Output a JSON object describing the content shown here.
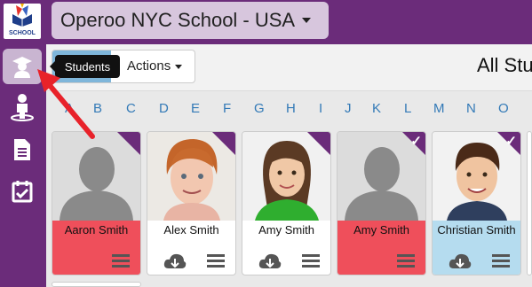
{
  "header": {
    "school_title": "Operoo NYC School - USA",
    "logo_text": "SCHOOL"
  },
  "sidebar": {
    "tooltip": "Students",
    "items": [
      "students-icon",
      "people-icon",
      "document-icon",
      "calendar-check-icon"
    ]
  },
  "toolbar": {
    "actions_label": "Actions",
    "page_heading": "All Stu"
  },
  "alphabet": [
    "A",
    "B",
    "C",
    "D",
    "E",
    "F",
    "G",
    "H",
    "I",
    "J",
    "K",
    "L",
    "M",
    "N",
    "O"
  ],
  "students": [
    {
      "name": "Aaron Smith",
      "status": "red",
      "photo": "placeholder",
      "checked": false,
      "download": false
    },
    {
      "name": "Alex Smith",
      "status": "white",
      "photo": "boy-red-hair",
      "checked": false,
      "download": true
    },
    {
      "name": "Amy Smith",
      "status": "white",
      "photo": "girl",
      "checked": false,
      "download": true
    },
    {
      "name": "Amy Smith",
      "status": "red",
      "photo": "placeholder",
      "checked": true,
      "download": false
    },
    {
      "name": "Christian Smith",
      "status": "blue",
      "photo": "boy",
      "checked": true,
      "download": true
    }
  ],
  "colors": {
    "purple": "#6b2c7a",
    "alert_red": "#ef4f5b",
    "info_blue": "#b5dcef",
    "link_blue": "#337ab7",
    "arrow_red": "#e8222a"
  }
}
